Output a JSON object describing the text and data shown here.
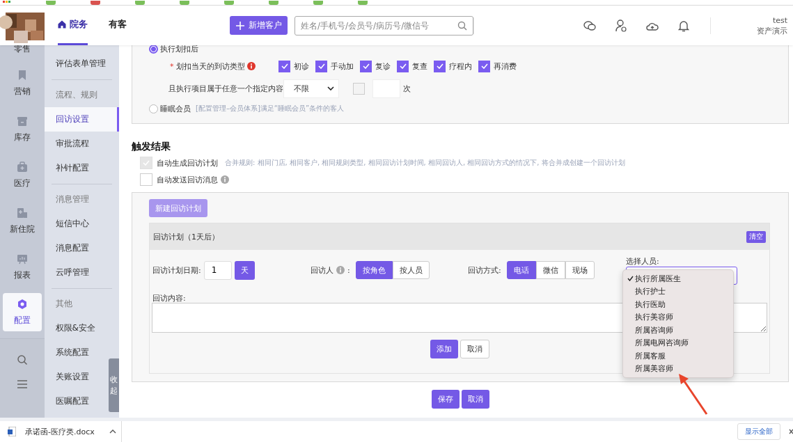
{
  "header": {
    "tabs": [
      {
        "label": "院务",
        "selected": true
      },
      {
        "label": "有客",
        "selected": false
      }
    ],
    "new_button": "新增客户",
    "search": {
      "placeholder": "姓名/手机号/会员号/病历号/微信号"
    },
    "user": {
      "name": "test",
      "org": "资产演示"
    }
  },
  "rail": [
    {
      "label": "零售",
      "selected": false
    },
    {
      "label": "营销",
      "selected": false
    },
    {
      "label": "库存",
      "selected": false
    },
    {
      "label": "医疗",
      "selected": false
    },
    {
      "label": "新住院",
      "selected": false
    },
    {
      "label": "报表",
      "selected": false
    },
    {
      "label": "配置",
      "selected": true
    }
  ],
  "submenu": {
    "collapse_label": "收起",
    "items": [
      {
        "label": "评估表单管理",
        "kind": "item",
        "selected": false
      },
      {
        "label": "流程、规则",
        "kind": "group"
      },
      {
        "label": "回访设置",
        "kind": "item",
        "selected": true
      },
      {
        "label": "审批流程",
        "kind": "item",
        "selected": false
      },
      {
        "label": "补针配置",
        "kind": "item",
        "selected": false
      },
      {
        "label": "消息管理",
        "kind": "group"
      },
      {
        "label": "短信中心",
        "kind": "item",
        "selected": false
      },
      {
        "label": "消息配置",
        "kind": "item",
        "selected": false
      },
      {
        "label": "云呼管理",
        "kind": "item",
        "selected": false
      },
      {
        "label": "其他",
        "kind": "group"
      },
      {
        "label": "权限&安全",
        "kind": "item",
        "selected": false
      },
      {
        "label": "系统配置",
        "kind": "item",
        "selected": false
      },
      {
        "label": "关账设置",
        "kind": "item",
        "selected": false
      },
      {
        "label": "医嘱配置",
        "kind": "item",
        "selected": false
      }
    ]
  },
  "trigger": {
    "option1": {
      "label": "执行划扣后",
      "selected": true
    },
    "visit_types": {
      "label": "划扣当天的到访类型",
      "required_mark": "*",
      "options": [
        {
          "label": "初诊",
          "checked": true
        },
        {
          "label": "手动加",
          "checked": true
        },
        {
          "label": "复诊",
          "checked": true
        },
        {
          "label": "复查",
          "checked": true
        },
        {
          "label": "疗程内",
          "checked": true
        },
        {
          "label": "再消费",
          "checked": true
        }
      ]
    },
    "item_filter": {
      "label": "且执行项目属于任意一个指定内容",
      "select": "不限",
      "checked": false,
      "unit": "次"
    },
    "option2": {
      "label": "睡眠会员",
      "selected": false,
      "hint": "[配置管理–会员体系]满足“睡眠会员”条件的客人"
    }
  },
  "result": {
    "title": "触发结果",
    "auto_plan": {
      "label": "自动生成回访计划",
      "checked": true,
      "disabled": true,
      "hint": "合并规则: 相同门店, 相同客户, 相同规则类型, 相同回访计划时间, 相同回访人, 相同回访方式的情况下, 将合并成创建一个回访计划"
    },
    "auto_message": {
      "label": "自动发送回访消息",
      "checked": false
    }
  },
  "plan_panel": {
    "new_button": "新建回访计划",
    "plan": {
      "title": "回访计划（1天后）",
      "clear_button": "清空",
      "date_label": "回访计划日期:",
      "date_value": "1",
      "date_unit": "天",
      "visitor_label": "回访人",
      "visitor_colon": ":",
      "visitor_modes": [
        {
          "label": "按角色",
          "selected": true
        },
        {
          "label": "按人员",
          "selected": false
        }
      ],
      "method_label": "回访方式:",
      "methods": [
        {
          "label": "电话",
          "selected": true
        },
        {
          "label": "微信",
          "selected": false
        },
        {
          "label": "现场",
          "selected": false
        }
      ],
      "staff_label": "选择人员:",
      "content_label": "回访内容:",
      "add_button": "添加",
      "cancel_button": "取消"
    },
    "dropdown": [
      {
        "label": "执行所属医生",
        "selected": true
      },
      {
        "label": "执行护士",
        "selected": false
      },
      {
        "label": "执行医助",
        "selected": false
      },
      {
        "label": "执行美容师",
        "selected": false
      },
      {
        "label": "所属咨询师",
        "selected": false
      },
      {
        "label": "所属电网咨询师",
        "selected": false
      },
      {
        "label": "所属客服",
        "selected": false
      },
      {
        "label": "所属美容师",
        "selected": false
      }
    ]
  },
  "footer_buttons": [
    "保存",
    "取消"
  ],
  "download_bar": {
    "file": "承诺函-医疗类.docx",
    "show_all": "显示全部"
  }
}
